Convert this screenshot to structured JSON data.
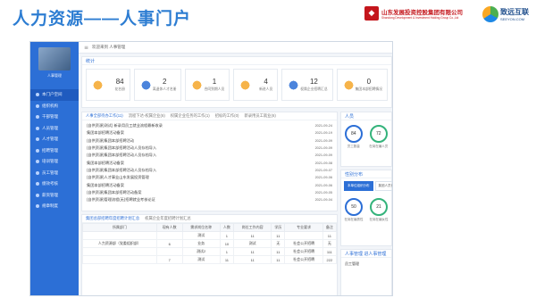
{
  "slide": {
    "title": "人力资源——人事门户",
    "brand_a_cn": "山东发展投资控股集团有限公司",
    "brand_a_en": "Shandong Development & Investment Holding Group Co.,Ltd",
    "brand_b_cn": "致远互联",
    "brand_b_en": "SEEYON.COM"
  },
  "sidebar": {
    "user_name": "人事管理",
    "items": [
      {
        "label": "本门户空间",
        "icon": "home-icon"
      },
      {
        "label": "组织机构",
        "icon": "org-icon"
      },
      {
        "label": "干部管理",
        "icon": "cadre-icon"
      },
      {
        "label": "人员管理",
        "icon": "user-icon"
      },
      {
        "label": "人才管理",
        "icon": "talent-icon"
      },
      {
        "label": "招聘管理",
        "icon": "recruit-icon"
      },
      {
        "label": "培训管理",
        "icon": "training-icon"
      },
      {
        "label": "员工管理",
        "icon": "staff-icon"
      },
      {
        "label": "绩效考核",
        "icon": "kpi-icon"
      },
      {
        "label": "薪资管理",
        "icon": "salary-icon"
      },
      {
        "label": "规章制度",
        "icon": "rules-icon"
      }
    ]
  },
  "topbar": {
    "text": "欢迎来到 人事管理"
  },
  "stats": {
    "title": "统计",
    "items": [
      {
        "value": "84",
        "label": "花名册",
        "icon": "donut-icon",
        "color": "#f4a62a"
      },
      {
        "value": "2",
        "label": "离退休人才名册",
        "icon": "trend-icon",
        "color": "#2c6fd6"
      },
      {
        "value": "1",
        "label": "合同到期人员",
        "icon": "bar-icon",
        "color": "#f4a62a"
      },
      {
        "value": "4",
        "label": "新进人员",
        "icon": "area-icon",
        "color": "#f4a62a"
      },
      {
        "value": "12",
        "label": "权属企业招聘汇总",
        "icon": "doc-icon",
        "color": "#2c6fd6"
      },
      {
        "value": "0",
        "label": "集团本部招聘情况",
        "icon": "pie-icon",
        "color": "#f4a62a"
      }
    ]
  },
  "tasks": {
    "tabs": [
      "人事全部待办工作(11)",
      "流程下达-权属企业(6)",
      "权属企业任务的工作(1)",
      "招标的工作(0)",
      "新录用员工就业(6)"
    ],
    "rows": [
      {
        "title": "(自供资源)测试) 新录用员工就业流程最新收录",
        "who": "",
        "date": "2021-09-24"
      },
      {
        "title": "集团本部招聘活动备案",
        "who": "",
        "date": "2021-09-19"
      },
      {
        "title": "(自供资源)集团本部招聘活动",
        "who": "",
        "date": "2021-09-09"
      },
      {
        "title": "(自供资源)集团本部招聘活动人员存档导入",
        "who": "",
        "date": "2021-09-09"
      },
      {
        "title": "(自供资源)集团本部招聘活动人员存档导入",
        "who": "",
        "date": "2021-09-09"
      },
      {
        "title": "集团本部招聘活动备案",
        "who": "",
        "date": "2021-09-08"
      },
      {
        "title": "(自供资源)集团本部招聘活动人员存档导入",
        "who": "",
        "date": "2021-09-07"
      },
      {
        "title": "(自供资源)人才事业山东发展投资管理",
        "who": "",
        "date": "2021-09-06"
      },
      {
        "title": "集团本部招聘活动备案",
        "who": "",
        "date": "2021-09-06"
      },
      {
        "title": "(自供资源)集团本部招聘活动备案",
        "who": "",
        "date": "2021-09-05"
      },
      {
        "title": "(自供资源)管理流程(无)招聘就业考核论证",
        "who": "",
        "date": "2021-09-04"
      }
    ]
  },
  "people": {
    "title": "人员",
    "items": [
      {
        "value": "84",
        "label": "员工数量",
        "color": "#2c6fd6"
      },
      {
        "value": "72",
        "label": "在岗在编人员",
        "color": "#34b37b"
      }
    ]
  },
  "dist": {
    "title": "性别分布",
    "tabs": [
      "本单位组织分布",
      "集团人员分布"
    ],
    "items": [
      {
        "value": "50",
        "label": "在岗在编男性",
        "color": "#2c6fd6"
      },
      {
        "value": "21",
        "label": "在岗在编女性",
        "color": "#34b37b"
      }
    ]
  },
  "mgmt": {
    "title": "人事管理  进人事管理",
    "sub": "员工管理"
  },
  "summary": {
    "tabs": [
      "集团总部招聘年度招聘计划汇总",
      "权属企业年度招聘计划汇总"
    ],
    "headers": [
      "所属部门",
      "现有人数",
      "需求岗位名称",
      "人数",
      "岗位工作内容",
      "学历",
      "专业要求",
      "备注"
    ],
    "rows": [
      [
        "",
        "",
        "测试",
        "1",
        "11",
        "11",
        "",
        "11"
      ],
      [
        "人力资源部（党委组织部）",
        "6",
        "业务",
        "10",
        "测试",
        "无",
        "社会公开招聘",
        "无"
      ],
      [
        "",
        "",
        "测试2",
        "1",
        "11",
        "11",
        "社会公开招聘",
        "111"
      ],
      [
        "",
        "7",
        "测试",
        "11",
        "11",
        "11",
        "社会公开招聘",
        "222"
      ]
    ]
  }
}
